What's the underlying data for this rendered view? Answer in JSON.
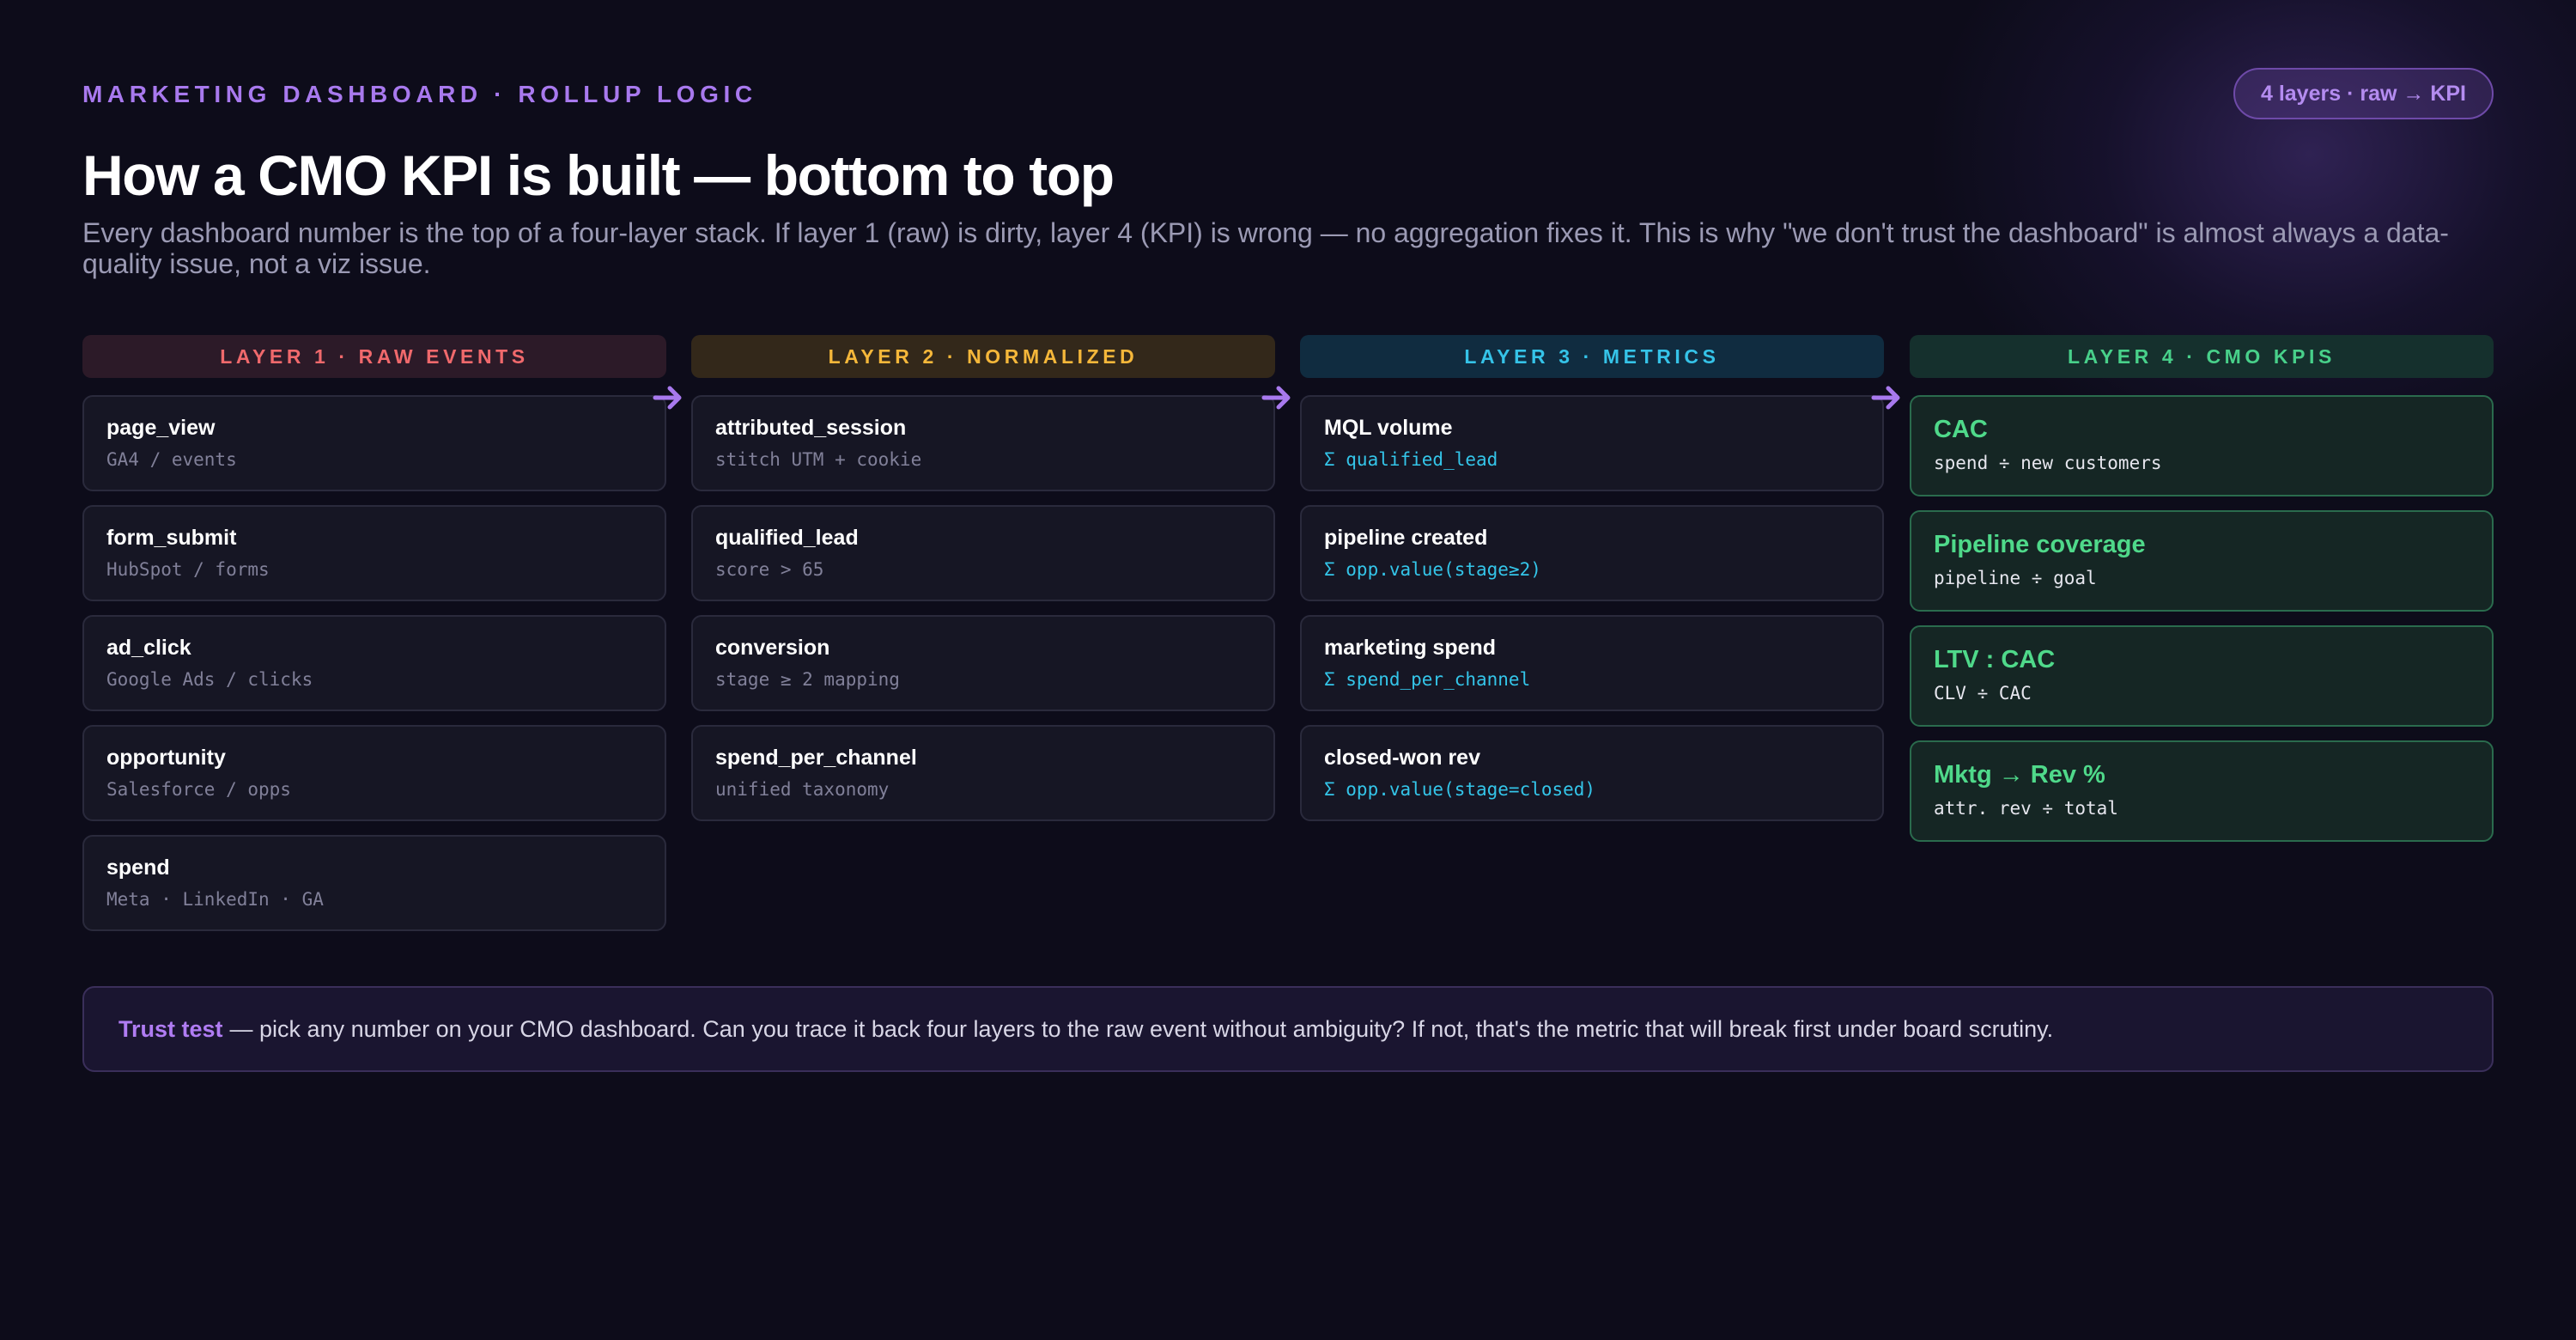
{
  "header": {
    "eyebrow": "MARKETING DASHBOARD · ROLLUP LOGIC",
    "badge": "4 layers · raw → KPI",
    "title": "How a CMO KPI is built — bottom to top",
    "subtitle": "Every dashboard number is the top of a four-layer stack. If layer 1 (raw) is dirty, layer 4 (KPI) is wrong — no aggregation fixes it. This is why \"we don't trust the dashboard\" is almost always a data-quality issue, not a viz issue."
  },
  "layers": [
    {
      "label": "LAYER 1 · RAW EVENTS",
      "color": "#f0696c",
      "items": [
        {
          "name": "page_view",
          "detail": "GA4 / events"
        },
        {
          "name": "form_submit",
          "detail": "HubSpot / forms"
        },
        {
          "name": "ad_click",
          "detail": "Google Ads / clicks"
        },
        {
          "name": "opportunity",
          "detail": "Salesforce / opps"
        },
        {
          "name": "spend",
          "detail": "Meta · LinkedIn · GA"
        }
      ]
    },
    {
      "label": "LAYER 2 · NORMALIZED",
      "color": "#f5b73a",
      "items": [
        {
          "name": "attributed_session",
          "detail": "stitch UTM + cookie"
        },
        {
          "name": "qualified_lead",
          "detail": "score > 65"
        },
        {
          "name": "conversion",
          "detail": "stage ≥ 2 mapping"
        },
        {
          "name": "spend_per_channel",
          "detail": "unified taxonomy"
        }
      ]
    },
    {
      "label": "LAYER 3 · METRICS",
      "color": "#35c3e8",
      "items": [
        {
          "name": "MQL volume",
          "detail": "Σ qualified_lead"
        },
        {
          "name": "pipeline created",
          "detail": "Σ opp.value(stage≥2)"
        },
        {
          "name": "marketing spend",
          "detail": "Σ spend_per_channel"
        },
        {
          "name": "closed-won rev",
          "detail": "Σ opp.value(stage=closed)"
        }
      ]
    },
    {
      "label": "LAYER 4 · CMO KPIS",
      "color": "#48d08a",
      "items": [
        {
          "name": "CAC",
          "detail": "spend ÷ new customers"
        },
        {
          "name": "Pipeline coverage",
          "detail": "pipeline ÷ goal"
        },
        {
          "name": "LTV : CAC",
          "detail": "CLV ÷ CAC"
        },
        {
          "name": "Mktg → Rev %",
          "detail": "attr. rev ÷ total"
        }
      ]
    }
  ],
  "arrow_icon": "arrow-right-icon",
  "trust_test": {
    "label": "Trust test",
    "text": "— pick any number on your CMO dashboard. Can you trace it back four layers to the raw event without ambiguity? If not, that's the metric that will break first under board scrutiny."
  }
}
